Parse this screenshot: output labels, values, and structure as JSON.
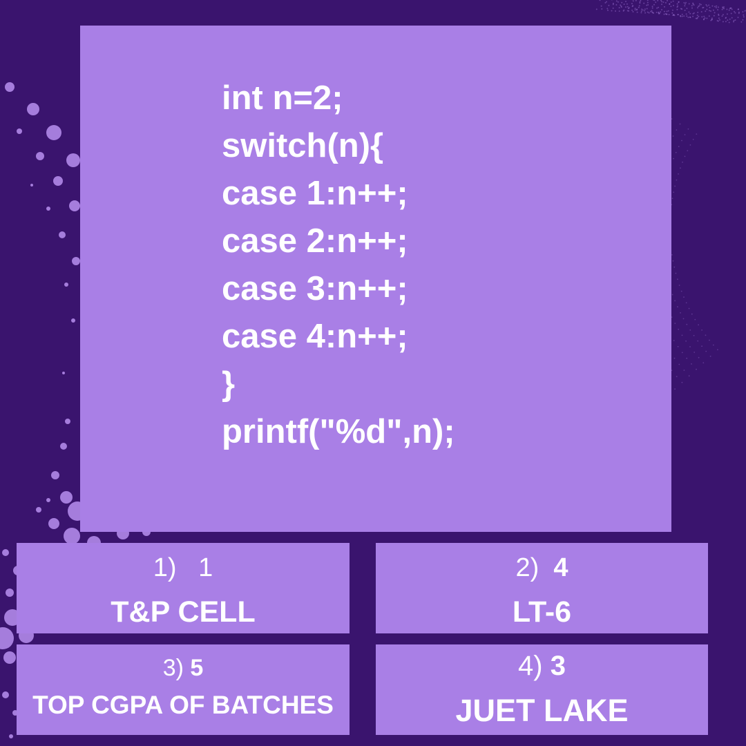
{
  "colors": {
    "background": "#3a146e",
    "panel": "#a97fe6",
    "text": "#ffffff",
    "dots": "#b98ff0"
  },
  "code_lines": [
    "int n=2;",
    "switch(n){",
    "case 1:n++;",
    "case 2:n++;",
    "case 3:n++;",
    "case 4:n++;",
    "}",
    "printf(\"%d\",n);"
  ],
  "options": [
    {
      "number": "1)   ",
      "answer": "1",
      "place": "T&P CELL"
    },
    {
      "number": "2)  ",
      "answer": "4",
      "place": "LT-6"
    },
    {
      "number": "3) ",
      "answer": "5",
      "place": "TOP CGPA OF BATCHES"
    },
    {
      "number": "4) ",
      "answer": "3",
      "place": "JUET LAKE"
    }
  ]
}
